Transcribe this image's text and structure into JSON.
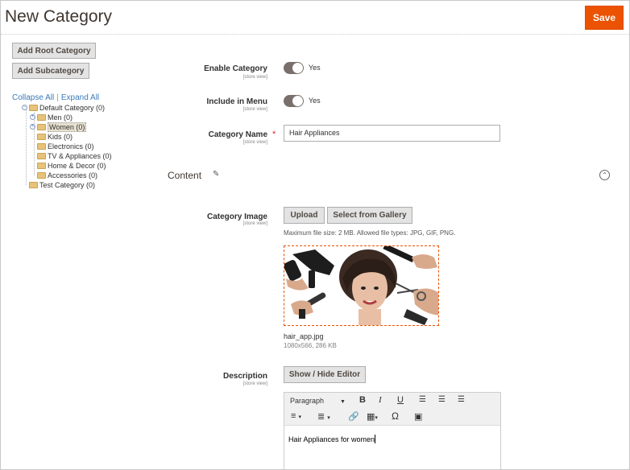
{
  "header": {
    "title": "New Category",
    "save_label": "Save"
  },
  "left": {
    "add_root_label": "Add Root Category",
    "add_sub_label": "Add Subcategory",
    "collapse_all": "Collapse All",
    "separator": "|",
    "expand_all": "Expand All",
    "tree": {
      "root": "Default Category (0)",
      "children": [
        "Men (0)",
        "Women (0)",
        "Kids (0)",
        "Electronics (0)",
        "TV & Appliances (0)",
        "Home & Decor (0)",
        "Accessories (0)"
      ],
      "test": "Test Category (0)"
    }
  },
  "form": {
    "enable_category": {
      "label": "Enable Category",
      "scope": "[store view]",
      "value": "Yes"
    },
    "include_in_menu": {
      "label": "Include in Menu",
      "scope": "[store view]",
      "value": "Yes"
    },
    "category_name": {
      "label": "Category Name",
      "scope": "[store view]",
      "required": "*",
      "value": "Hair Appliances"
    },
    "content_title": "Content",
    "category_image": {
      "label": "Category Image",
      "scope": "[store view]",
      "upload_label": "Upload",
      "gallery_label": "Select from Gallery",
      "note": "Maximum file size: 2 MB. Allowed file types: JPG, GIF, PNG.",
      "file_name": "hair_app.jpg",
      "file_meta": "1080x566, 286 KB"
    },
    "description": {
      "label": "Description",
      "scope": "[store view]",
      "toggle_editor_label": "Show / Hide Editor",
      "format_select": "Paragraph",
      "content": "Hair Appliances for women"
    }
  },
  "colors": {
    "accent": "#eb5202",
    "toggle": "#79706b",
    "link": "#3c7ab8"
  }
}
